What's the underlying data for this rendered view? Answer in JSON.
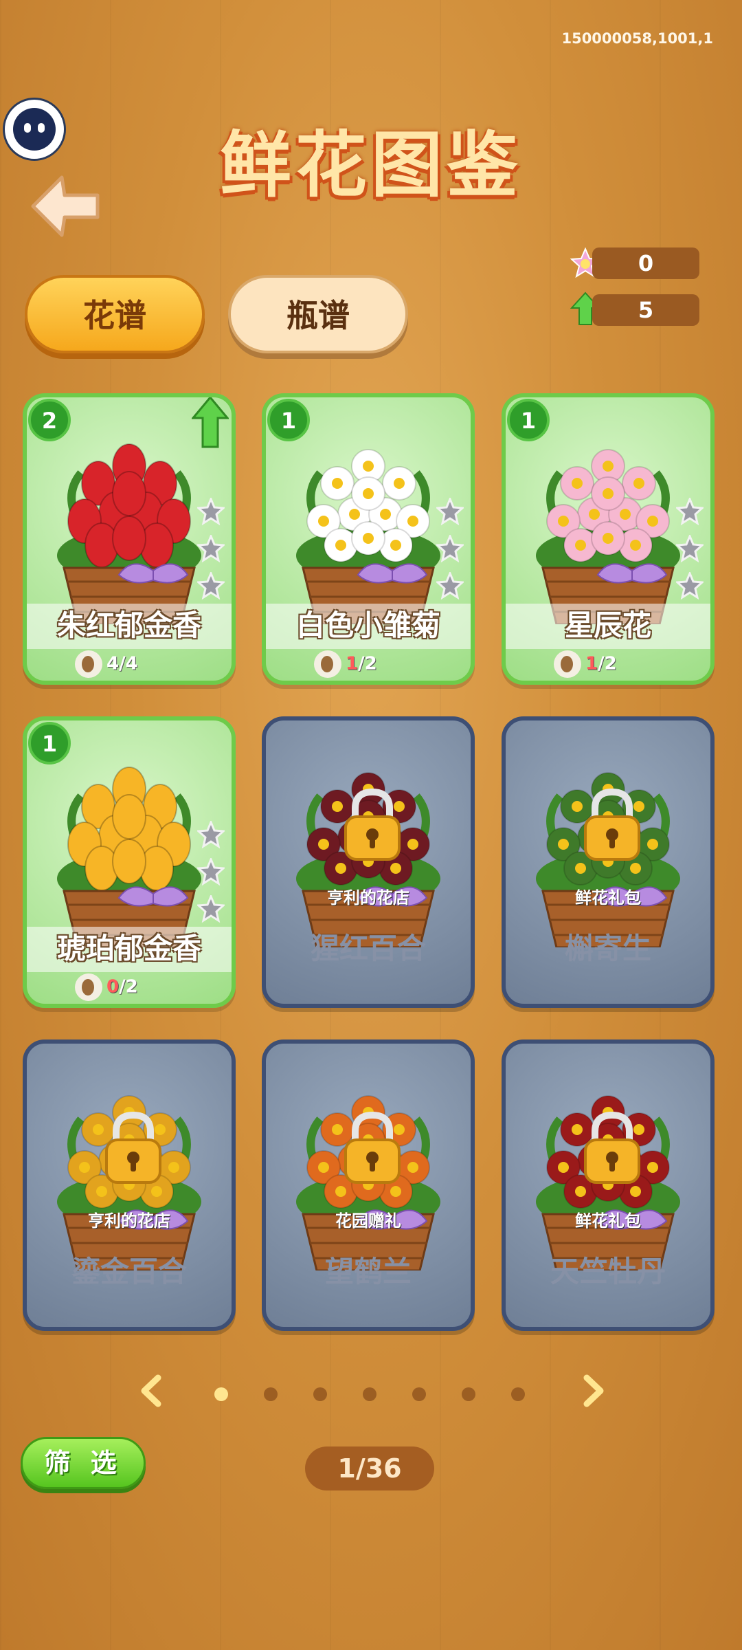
{
  "debug_id": "150000058,1001,1",
  "title": "鲜花图鉴",
  "tabs": [
    {
      "label": "花谱",
      "active": true
    },
    {
      "label": "瓶谱",
      "active": false
    }
  ],
  "counters": {
    "stars": "0",
    "upgrades": "5"
  },
  "cards": [
    {
      "name": "朱红郁金香",
      "level": "2",
      "locked": false,
      "upgradable": true,
      "progress_have": "4",
      "progress_total": "/4",
      "flower_color": "#d8242a",
      "flower_type": "tulip"
    },
    {
      "name": "白色小雏菊",
      "level": "1",
      "locked": false,
      "upgradable": false,
      "progress_have": "1",
      "progress_total": "/2",
      "flower_color": "#ffffff",
      "flower_type": "daisy"
    },
    {
      "name": "星辰花",
      "level": "1",
      "locked": false,
      "upgradable": false,
      "progress_have": "1",
      "progress_total": "/2",
      "flower_color": "#f6b8d0",
      "flower_type": "daisy"
    },
    {
      "name": "琥珀郁金香",
      "level": "1",
      "locked": false,
      "upgradable": false,
      "progress_have": "0",
      "progress_total": "/2",
      "flower_color": "#f7b526",
      "flower_type": "tulip"
    },
    {
      "name": "猩红百合",
      "locked": true,
      "source": "亨利的花店",
      "flower_color": "#6e1a22"
    },
    {
      "name": "槲寄生",
      "locked": true,
      "source": "鲜花礼包",
      "flower_color": "#3f7a2a"
    },
    {
      "name": "鎏金百合",
      "locked": true,
      "source": "亨利的花店",
      "flower_color": "#e2a31e"
    },
    {
      "name": "望鹤兰",
      "locked": true,
      "source": "花园赠礼",
      "flower_color": "#e06a1e"
    },
    {
      "name": "天竺牡丹",
      "locked": true,
      "source": "鲜花礼包",
      "flower_color": "#9a1a1a"
    }
  ],
  "pager": {
    "dots": 7,
    "active_index": 0,
    "page_text": "1/36"
  },
  "filter_label": "筛 选",
  "colors": {
    "title_fill": "#ffe6a8",
    "title_outline": "#d0531a",
    "card_unlocked_border": "#6ecb4a",
    "card_locked_border": "#3e4f74",
    "progress_missing": "#ff5a5a"
  }
}
